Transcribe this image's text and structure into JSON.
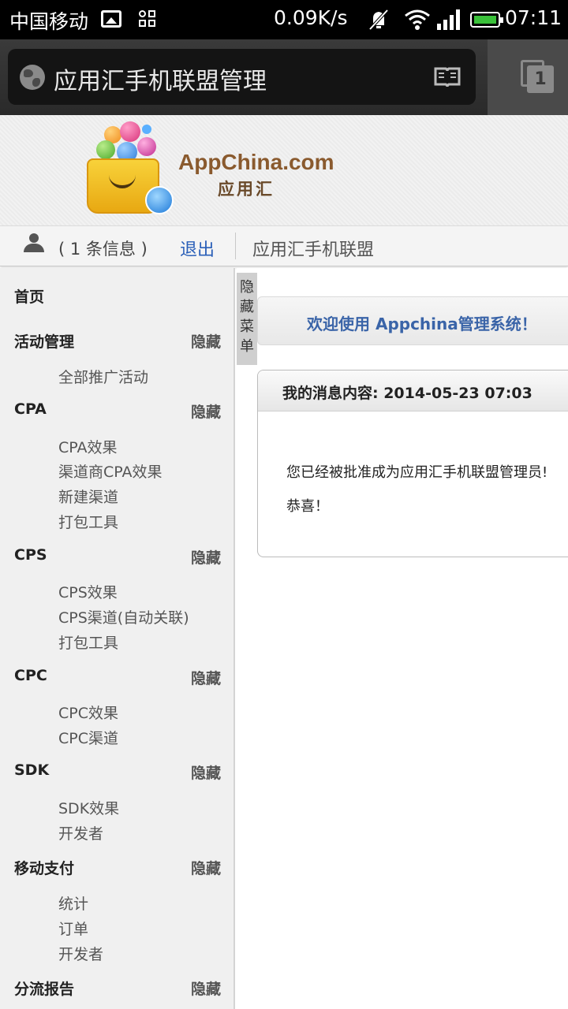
{
  "status_bar": {
    "carrier": "中国移动",
    "speed": "0.09K/s",
    "time": "07:11",
    "icons": [
      "image-icon",
      "grid-icon",
      "mute-icon",
      "wifi-icon",
      "signal-icon",
      "battery-icon"
    ]
  },
  "browser": {
    "page_title": "应用汇手机联盟管理",
    "tab_count": "1"
  },
  "header": {
    "logo_text": "AppChina.com",
    "logo_sub": "应用汇"
  },
  "user_bar": {
    "message_count": "( 1 条信息 )",
    "logout": "退出",
    "title": "应用汇手机联盟"
  },
  "sidebar": {
    "home": "首页",
    "sections": [
      {
        "title": "活动管理",
        "hide": "隐藏",
        "items": [
          "全部推广活动"
        ]
      },
      {
        "title": "CPA",
        "hide": "隐藏",
        "items": [
          "CPA效果",
          "渠道商CPA效果",
          "新建渠道",
          "打包工具"
        ]
      },
      {
        "title": "CPS",
        "hide": "隐藏",
        "items": [
          "CPS效果",
          "CPS渠道(自动关联)",
          "打包工具"
        ]
      },
      {
        "title": "CPC",
        "hide": "隐藏",
        "items": [
          "CPC效果",
          "CPC渠道"
        ]
      },
      {
        "title": "SDK",
        "hide": "隐藏",
        "items": [
          "SDK效果",
          "开发者"
        ]
      },
      {
        "title": "移动支付",
        "hide": "隐藏",
        "items": [
          "统计",
          "订单",
          "开发者"
        ]
      },
      {
        "title": "分流报告",
        "hide": "隐藏",
        "items": []
      }
    ]
  },
  "hide_menu": "隐藏菜单",
  "main": {
    "welcome": "欢迎使用 Appchina管理系统！",
    "message_title": "我的消息内容: 2014-05-23 07:03",
    "message_line1": "您已经被批准成为应用汇手机联盟管理员!",
    "message_line2": "恭喜！"
  },
  "colors": {
    "link": "#2a5fb8",
    "welcome": "#3a64a8",
    "battery": "#3ac13a"
  }
}
